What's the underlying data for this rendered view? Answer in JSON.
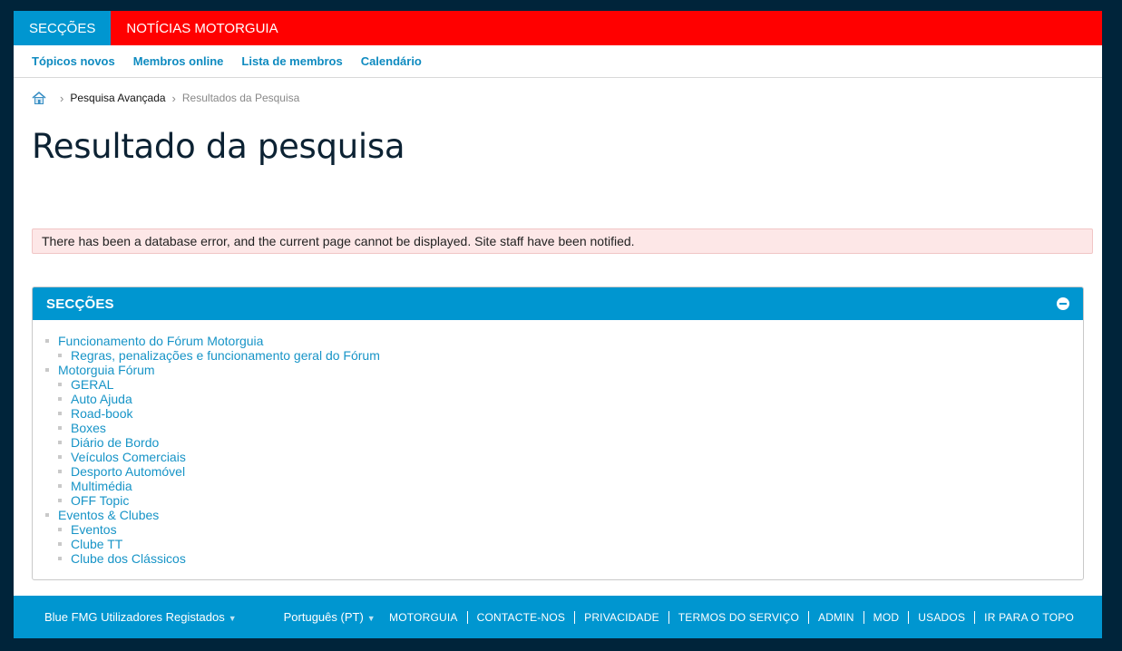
{
  "topbar": {
    "tabs": [
      {
        "label": "SECÇÕES",
        "active": true
      },
      {
        "label": "NOTÍCIAS MOTORGUIA",
        "active": false
      }
    ]
  },
  "subnav": {
    "links": [
      "Tópicos novos",
      "Membros online",
      "Lista de membros",
      "Calendário"
    ]
  },
  "breadcrumb": {
    "home_icon": "home-icon",
    "link": "Pesquisa Avançada",
    "current": "Resultados da Pesquisa"
  },
  "page_title": "Resultado da pesquisa",
  "error_message": "There has been a database error, and the current page cannot be displayed. Site staff have been notified.",
  "sections": {
    "title": "SECÇÕES",
    "collapse_icon": "minus-circle-icon",
    "items": [
      {
        "label": "Funcionamento do Fórum Motorguia",
        "level": 0
      },
      {
        "label": "Regras, penalizações e funcionamento geral do Fórum",
        "level": 1
      },
      {
        "label": "Motorguia Fórum",
        "level": 0
      },
      {
        "label": "GERAL",
        "level": 1
      },
      {
        "label": "Auto Ajuda",
        "level": 1
      },
      {
        "label": "Road-book",
        "level": 1
      },
      {
        "label": "Boxes",
        "level": 1
      },
      {
        "label": "Diário de Bordo",
        "level": 1
      },
      {
        "label": "Veículos Comerciais",
        "level": 1
      },
      {
        "label": "Desporto Automóvel",
        "level": 1
      },
      {
        "label": "Multimédia",
        "level": 1
      },
      {
        "label": "OFF Topic",
        "level": 1
      },
      {
        "label": "Eventos & Clubes",
        "level": 0
      },
      {
        "label": "Eventos",
        "level": 1
      },
      {
        "label": "Clube TT",
        "level": 1
      },
      {
        "label": "Clube dos Clássicos",
        "level": 1
      }
    ]
  },
  "footer": {
    "style_chooser": "Blue FMG Utilizadores Registados",
    "language_chooser": "Português (PT)",
    "caret": "▼",
    "links": [
      "MOTORGUIA",
      "CONTACTE-NOS",
      "PRIVACIDADE",
      "TERMOS DO SERVIÇO",
      "ADMIN",
      "MOD",
      "USADOS",
      "IR PARA O TOPO"
    ]
  },
  "colors": {
    "topbar_bg": "#ff0000",
    "accent_blue": "#0096d0",
    "link_blue": "#1794c7",
    "error_bg": "#fde7e7",
    "page_outer_bg": "#00243a"
  }
}
